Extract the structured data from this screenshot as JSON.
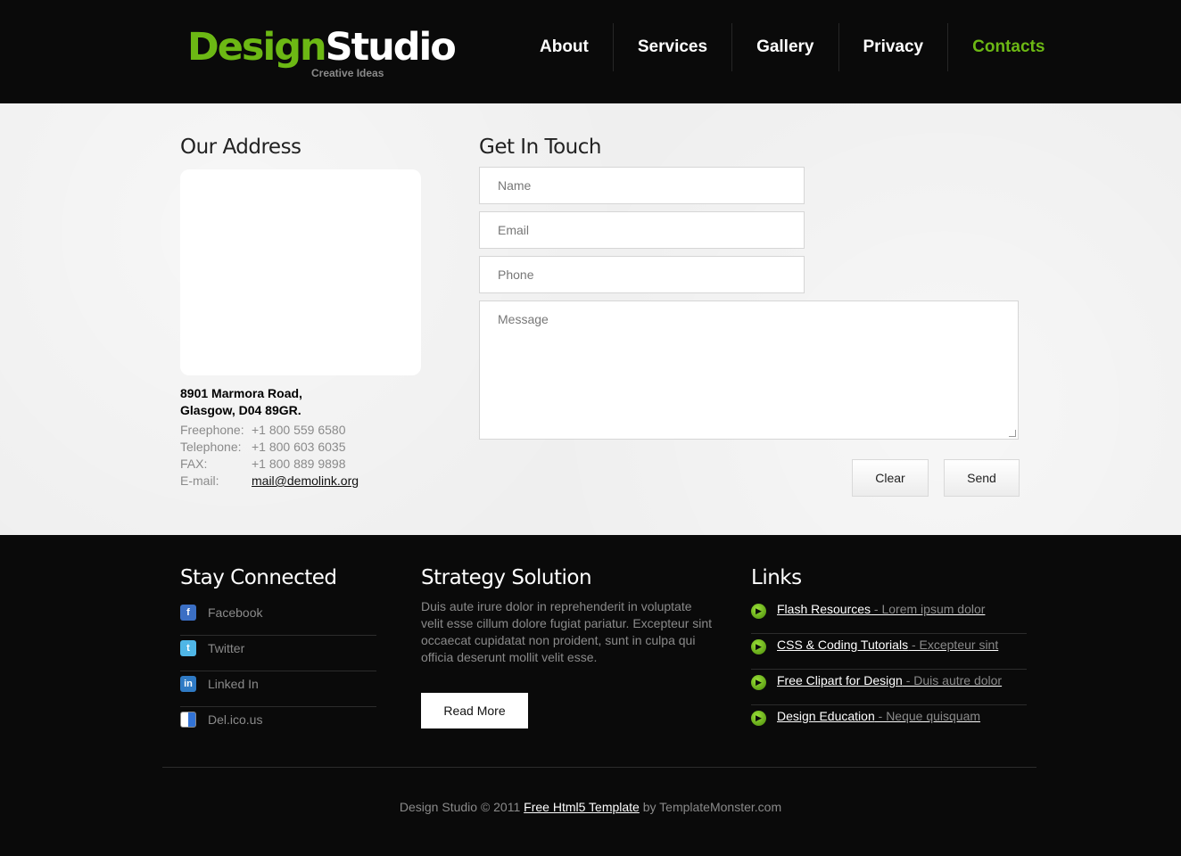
{
  "header": {
    "logo_part1": "Design",
    "logo_part2": "Studio",
    "tagline": "Creative Ideas",
    "nav": [
      {
        "label": "About"
      },
      {
        "label": "Services"
      },
      {
        "label": "Gallery"
      },
      {
        "label": "Privacy"
      },
      {
        "label": "Contacts",
        "active": true
      }
    ]
  },
  "address": {
    "title": "Our Address",
    "street": "8901 Marmora Road,",
    "city": "Glasgow, D04 89GR.",
    "freephone_label": "Freephone:",
    "freephone": "+1 800 559 6580",
    "telephone_label": "Telephone:",
    "telephone": "+1 800 603 6035",
    "fax_label": "FAX:",
    "fax": "+1 800 889 9898",
    "email_label": "E-mail:",
    "email": "mail@demolink.org"
  },
  "contact_form": {
    "title": "Get In Touch",
    "name_placeholder": "Name",
    "email_placeholder": "Email",
    "phone_placeholder": "Phone",
    "message_placeholder": "Message",
    "clear_label": "Clear",
    "send_label": "Send"
  },
  "footer": {
    "stay_connected": {
      "title": "Stay Connected",
      "items": [
        {
          "label": "Facebook",
          "icon": "facebook-icon"
        },
        {
          "label": "Twitter",
          "icon": "twitter-icon"
        },
        {
          "label": "Linked In",
          "icon": "linkedin-icon"
        },
        {
          "label": "Del.ico.us",
          "icon": "delicious-icon"
        }
      ]
    },
    "strategy": {
      "title": "Strategy Solution",
      "text": "Duis aute irure dolor in reprehenderit in voluptate velit esse cillum dolore fugiat pariatur. Excepteur sint occaecat cupidatat non proident, sunt in culpa qui officia deserunt mollit velit esse.",
      "button": "Read More"
    },
    "links": {
      "title": "Links",
      "items": [
        {
          "link": "Flash Resources",
          "desc": " - Lorem ipsum dolor"
        },
        {
          "link": "CSS & Coding Tutorials",
          "desc": " - Excepteur sint"
        },
        {
          "link": "Free Clipart for Design",
          "desc": " - Duis autre dolor"
        },
        {
          "link": "Design Education",
          "desc": " - Neque quisquam"
        }
      ]
    },
    "copyright_prefix": "Design Studio © 2011 ",
    "copyright_link": "Free Html5 Template",
    "copyright_suffix": " by TemplateMonster.com"
  },
  "colors": {
    "accent": "#6cb814",
    "header_bg": "#0a0a0a",
    "content_bg": "#efefef",
    "text_muted": "#8a8a8a"
  }
}
